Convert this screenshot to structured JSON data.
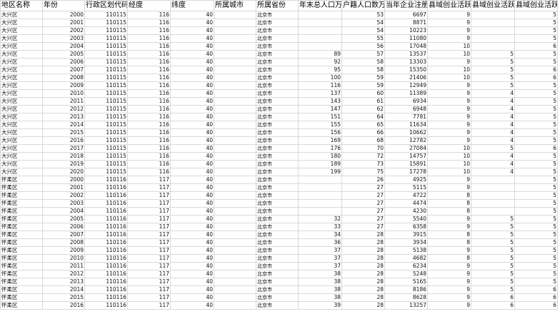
{
  "headers": [
    "地区名称",
    "年份",
    "行政区划代码",
    "经度",
    "纬度",
    "所属城市",
    "所属省份",
    "年末总人口万人",
    "户籍人口数万人",
    "当年企业注册数",
    "县域创业活跃度",
    "县域创业活跃度",
    "县域创业活跃度"
  ],
  "rows": [
    [
      "大兴区",
      "2000",
      "110115",
      "116",
      "40",
      "",
      "北京市",
      "",
      "53",
      "6697",
      "9",
      "",
      "5"
    ],
    [
      "大兴区",
      "2001",
      "110115",
      "116",
      "40",
      "",
      "北京市",
      "",
      "54",
      "8871",
      "9",
      "",
      "5"
    ],
    [
      "大兴区",
      "2002",
      "110115",
      "116",
      "40",
      "",
      "北京市",
      "",
      "54",
      "10223",
      "9",
      "",
      "5"
    ],
    [
      "大兴区",
      "2003",
      "110115",
      "116",
      "40",
      "",
      "北京市",
      "",
      "55",
      "11080",
      "9",
      "",
      "5"
    ],
    [
      "大兴区",
      "2004",
      "110115",
      "116",
      "40",
      "",
      "北京市",
      "",
      "56",
      "17048",
      "10",
      "",
      "6"
    ],
    [
      "大兴区",
      "2005",
      "110115",
      "116",
      "40",
      "",
      "北京市",
      "89",
      "57",
      "13537",
      "10",
      "5",
      "5"
    ],
    [
      "大兴区",
      "2006",
      "110115",
      "116",
      "40",
      "",
      "北京市",
      "92",
      "58",
      "13303",
      "9",
      "5",
      "5"
    ],
    [
      "大兴区",
      "2007",
      "110115",
      "116",
      "40",
      "",
      "北京市",
      "95",
      "58",
      "15350",
      "10",
      "5",
      "6"
    ],
    [
      "大兴区",
      "2008",
      "110115",
      "116",
      "40",
      "",
      "北京市",
      "100",
      "59",
      "21406",
      "10",
      "5",
      "6"
    ],
    [
      "大兴区",
      "2009",
      "110115",
      "116",
      "40",
      "",
      "北京市",
      "116",
      "59",
      "12949",
      "9",
      "5",
      "5"
    ],
    [
      "大兴区",
      "2010",
      "110115",
      "116",
      "40",
      "",
      "北京市",
      "137",
      "60",
      "11389",
      "9",
      "4",
      "5"
    ],
    [
      "大兴区",
      "2011",
      "110115",
      "116",
      "40",
      "",
      "北京市",
      "143",
      "61",
      "6934",
      "9",
      "4",
      "5"
    ],
    [
      "大兴区",
      "2012",
      "110115",
      "116",
      "40",
      "",
      "北京市",
      "147",
      "62",
      "6948",
      "9",
      "4",
      "5"
    ],
    [
      "大兴区",
      "2013",
      "110115",
      "116",
      "40",
      "",
      "北京市",
      "151",
      "64",
      "7781",
      "9",
      "4",
      "5"
    ],
    [
      "大兴区",
      "2014",
      "110115",
      "116",
      "40",
      "",
      "北京市",
      "155",
      "65",
      "11634",
      "9",
      "4",
      "5"
    ],
    [
      "大兴区",
      "2015",
      "110115",
      "116",
      "40",
      "",
      "北京市",
      "156",
      "66",
      "10662",
      "9",
      "4",
      "5"
    ],
    [
      "大兴区",
      "2016",
      "110115",
      "116",
      "40",
      "",
      "北京市",
      "169",
      "68",
      "12782",
      "9",
      "4",
      "5"
    ],
    [
      "大兴区",
      "2017",
      "110115",
      "116",
      "40",
      "",
      "北京市",
      "176",
      "70",
      "27084",
      "10",
      "5",
      "6"
    ],
    [
      "大兴区",
      "2018",
      "110115",
      "116",
      "40",
      "",
      "北京市",
      "180",
      "72",
      "14757",
      "10",
      "4",
      "5"
    ],
    [
      "大兴区",
      "2019",
      "110115",
      "116",
      "40",
      "",
      "北京市",
      "189",
      "73",
      "15891",
      "10",
      "4",
      "5"
    ],
    [
      "大兴区",
      "2020",
      "110115",
      "116",
      "40",
      "",
      "北京市",
      "199",
      "75",
      "17278",
      "10",
      "4",
      "5"
    ],
    [
      "怀柔区",
      "2000",
      "110116",
      "117",
      "40",
      "",
      "北京市",
      "",
      "26",
      "4925",
      "9",
      "",
      "5"
    ],
    [
      "怀柔区",
      "2001",
      "110116",
      "117",
      "40",
      "",
      "北京市",
      "",
      "27",
      "5115",
      "9",
      "",
      "5"
    ],
    [
      "怀柔区",
      "2002",
      "110116",
      "117",
      "40",
      "",
      "北京市",
      "",
      "27",
      "4722",
      "8",
      "",
      "5"
    ],
    [
      "怀柔区",
      "2003",
      "110116",
      "117",
      "40",
      "",
      "北京市",
      "",
      "27",
      "4474",
      "8",
      "",
      "5"
    ],
    [
      "怀柔区",
      "2004",
      "110116",
      "117",
      "40",
      "",
      "北京市",
      "",
      "27",
      "4230",
      "8",
      "",
      "5"
    ],
    [
      "怀柔区",
      "2005",
      "110116",
      "117",
      "40",
      "",
      "北京市",
      "32",
      "27",
      "5540",
      "9",
      "5",
      "5"
    ],
    [
      "怀柔区",
      "2006",
      "110116",
      "117",
      "40",
      "",
      "北京市",
      "33",
      "27",
      "6358",
      "9",
      "5",
      "5"
    ],
    [
      "怀柔区",
      "2007",
      "110116",
      "117",
      "40",
      "",
      "北京市",
      "34",
      "28",
      "3915",
      "8",
      "5",
      "5"
    ],
    [
      "怀柔区",
      "2008",
      "110116",
      "117",
      "40",
      "",
      "北京市",
      "36",
      "28",
      "3934",
      "8",
      "5",
      "5"
    ],
    [
      "怀柔区",
      "2009",
      "110116",
      "117",
      "40",
      "",
      "北京市",
      "37",
      "28",
      "5138",
      "9",
      "5",
      "5"
    ],
    [
      "怀柔区",
      "2010",
      "110116",
      "117",
      "40",
      "",
      "北京市",
      "37",
      "28",
      "4682",
      "8",
      "5",
      "5"
    ],
    [
      "怀柔区",
      "2011",
      "110116",
      "117",
      "40",
      "",
      "北京市",
      "37",
      "28",
      "6234",
      "9",
      "5",
      "5"
    ],
    [
      "怀柔区",
      "2012",
      "110116",
      "117",
      "40",
      "",
      "北京市",
      "38",
      "28",
      "5248",
      "9",
      "5",
      "5"
    ],
    [
      "怀柔区",
      "2013",
      "110116",
      "117",
      "40",
      "",
      "北京市",
      "38",
      "28",
      "5165",
      "9",
      "5",
      "5"
    ],
    [
      "怀柔区",
      "2014",
      "110116",
      "117",
      "40",
      "",
      "北京市",
      "38",
      "28",
      "8186",
      "9",
      "5",
      "6"
    ],
    [
      "怀柔区",
      "2015",
      "110116",
      "117",
      "40",
      "",
      "北京市",
      "38",
      "28",
      "8628",
      "9",
      "6",
      "6"
    ],
    [
      "怀柔区",
      "2016",
      "110116",
      "117",
      "40",
      "",
      "北京市",
      "39",
      "28",
      "13257",
      "9",
      "6",
      "6"
    ]
  ]
}
